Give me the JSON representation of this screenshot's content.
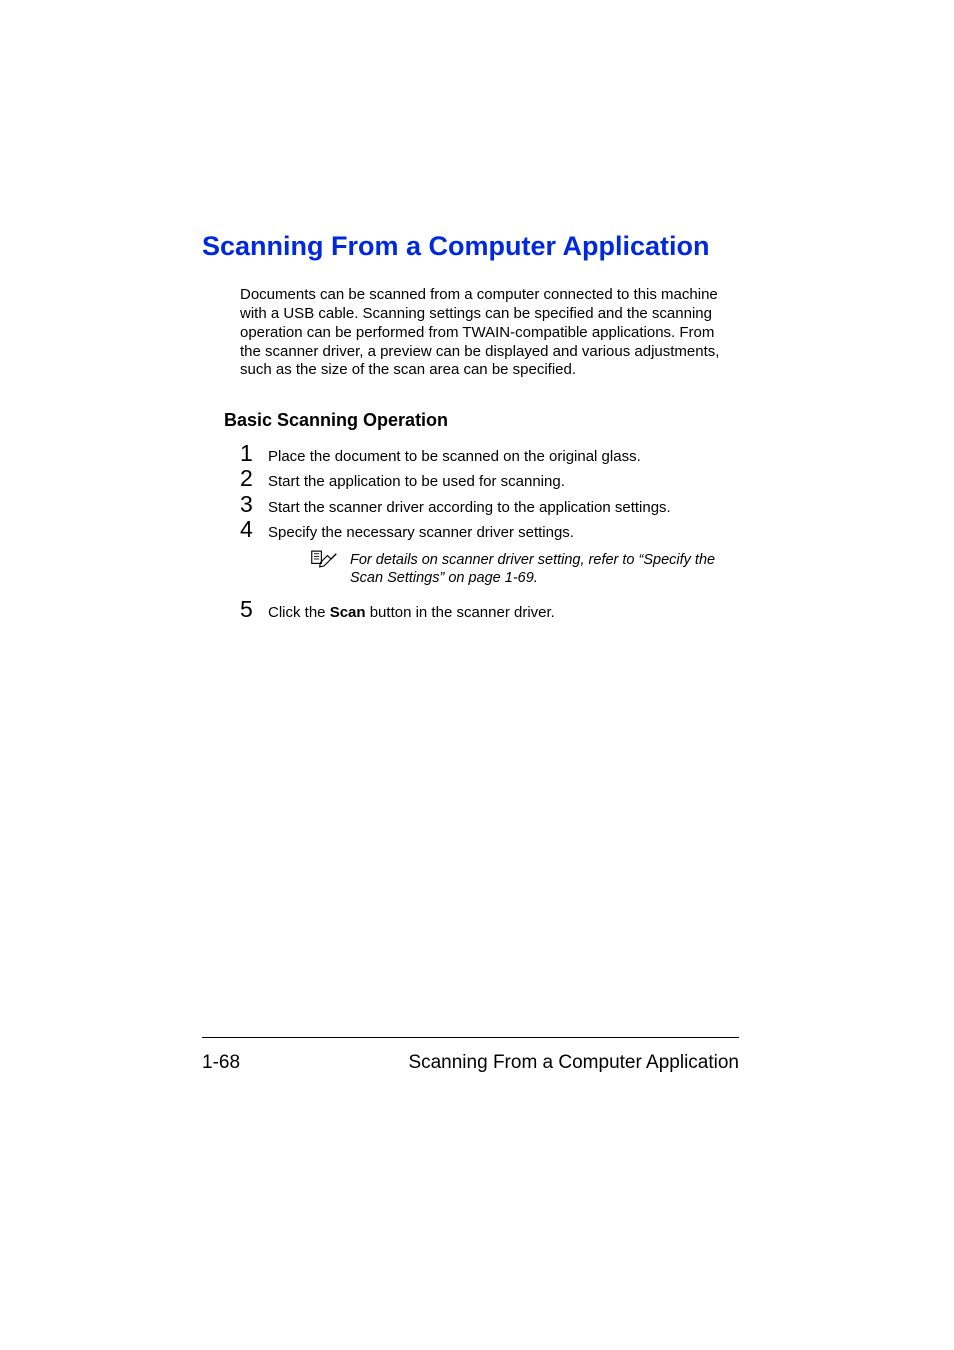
{
  "title": "Scanning From a Computer Application",
  "intro": "Documents can be scanned from a computer connected to this machine with a USB cable. Scanning settings can be specified and the scanning operation can be performed from TWAIN-compatible applications. From the scanner driver, a preview can be displayed and various adjustments, such as the size of the scan area can be specified.",
  "subheading": "Basic Scanning Operation",
  "steps": {
    "s1": {
      "num": "1",
      "text": "Place the document to be scanned on the original glass."
    },
    "s2": {
      "num": "2",
      "text": "Start the application to be used for scanning."
    },
    "s3": {
      "num": "3",
      "text": "Start the scanner driver according to the application settings."
    },
    "s4": {
      "num": "4",
      "text": "Specify the necessary scanner driver settings."
    },
    "s5": {
      "num": "5",
      "prefix": "Click the ",
      "bold": "Scan",
      "suffix": " button in the scanner driver."
    }
  },
  "note": "For details on scanner driver setting, refer to “Specify the Scan Settings” on page 1-69.",
  "footer": {
    "page": "1-68",
    "title": "Scanning From a Computer Application"
  }
}
